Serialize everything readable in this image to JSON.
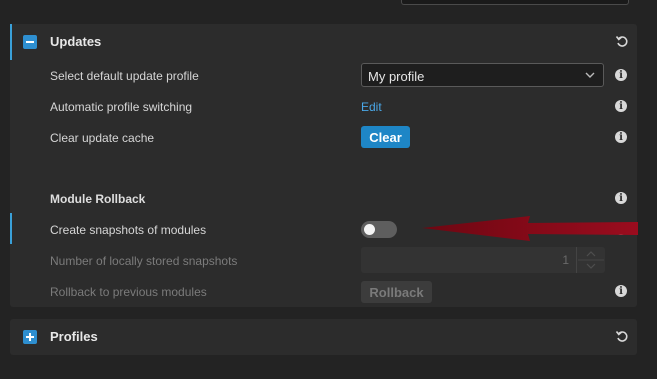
{
  "updates": {
    "title": "Updates",
    "rows": {
      "default_profile_label": "Select default update profile",
      "default_profile_value": "My profile",
      "auto_switch_label": "Automatic profile switching",
      "auto_switch_link": "Edit",
      "clear_cache_label": "Clear update cache",
      "clear_button": "Clear"
    },
    "rollback": {
      "heading": "Module Rollback",
      "snapshots_label": "Create snapshots of modules",
      "snapshots_enabled": false,
      "stored_label": "Number of locally stored snapshots",
      "stored_value": "1",
      "rollback_label": "Rollback to previous modules",
      "rollback_button": "Rollback"
    }
  },
  "profiles": {
    "title": "Profiles"
  },
  "colors": {
    "accent": "#3aa0d8",
    "primary_button": "#1e86c6",
    "annotation_arrow": "#8b0a1a"
  },
  "icons": [
    "collapse-icon",
    "expand-icon",
    "reset-icon",
    "info-icon",
    "chevron-down-icon",
    "annotation-arrow"
  ]
}
